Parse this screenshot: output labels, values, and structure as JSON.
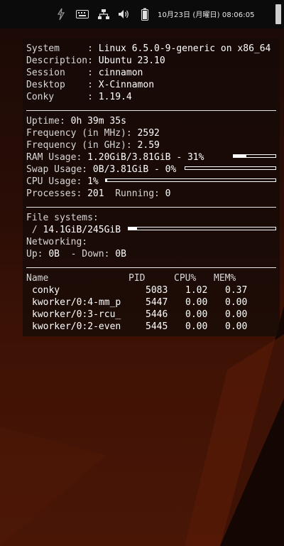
{
  "panel": {
    "clock": "10月23日 (月曜日) 08:06:05",
    "icons": [
      "network-sync-icon",
      "keyboard-icon",
      "network-icon",
      "volume-icon",
      "battery-icon"
    ]
  },
  "conky": {
    "system": {
      "label": "System     : ",
      "value": "Linux 6.5.0-9-generic on x86_64"
    },
    "description": {
      "label": "Description: ",
      "value": "Ubuntu 23.10"
    },
    "session": {
      "label": "Session    : ",
      "value": "cinnamon"
    },
    "desktop": {
      "label": "Desktop    : ",
      "value": "X-Cinnamon"
    },
    "conky_version": {
      "label": "Conky      : ",
      "value": "1.19.4"
    },
    "uptime": {
      "label": "Uptime: ",
      "value": "0h 39m 35s"
    },
    "freq_mhz": {
      "label": "Frequency (in MHz): ",
      "value": "2592"
    },
    "freq_ghz": {
      "label": "Frequency (in GHz): ",
      "value": "2.59"
    },
    "ram": {
      "label": "RAM Usage: ",
      "value": "1.20GiB/3.81GiB - 31%",
      "percent": 31
    },
    "swap": {
      "label": "Swap Usage: ",
      "value": "0B/3.81GiB - 0%",
      "percent": 0
    },
    "cpu": {
      "label": "CPU Usage: ",
      "value": "1%",
      "percent": 1
    },
    "processes": {
      "label": "Processes: ",
      "value": "201",
      "running_label": "  Running: ",
      "running_value": "0"
    },
    "filesystems": {
      "label": "File systems:",
      "root": " / ",
      "value": "14.1GiB/245GiB",
      "percent": 6
    },
    "networking": {
      "label": "Networking:",
      "up_label": "Up: ",
      "up_value": "0B",
      "down_label": "  - Down: ",
      "down_value": "0B"
    },
    "processes_table": {
      "headers": {
        "name": "Name",
        "pid": "PID",
        "cpu": "CPU%",
        "mem": "MEM%"
      },
      "rows": [
        {
          "name": "conky",
          "pid": "5083",
          "cpu": "1.02",
          "mem": "0.37"
        },
        {
          "name": "kworker/0:4-mm_p",
          "pid": "5447",
          "cpu": "0.00",
          "mem": "0.00"
        },
        {
          "name": "kworker/0:3-rcu_",
          "pid": "5446",
          "cpu": "0.00",
          "mem": "0.00"
        },
        {
          "name": "kworker/0:2-even",
          "pid": "5445",
          "cpu": "0.00",
          "mem": "0.00"
        }
      ]
    }
  }
}
